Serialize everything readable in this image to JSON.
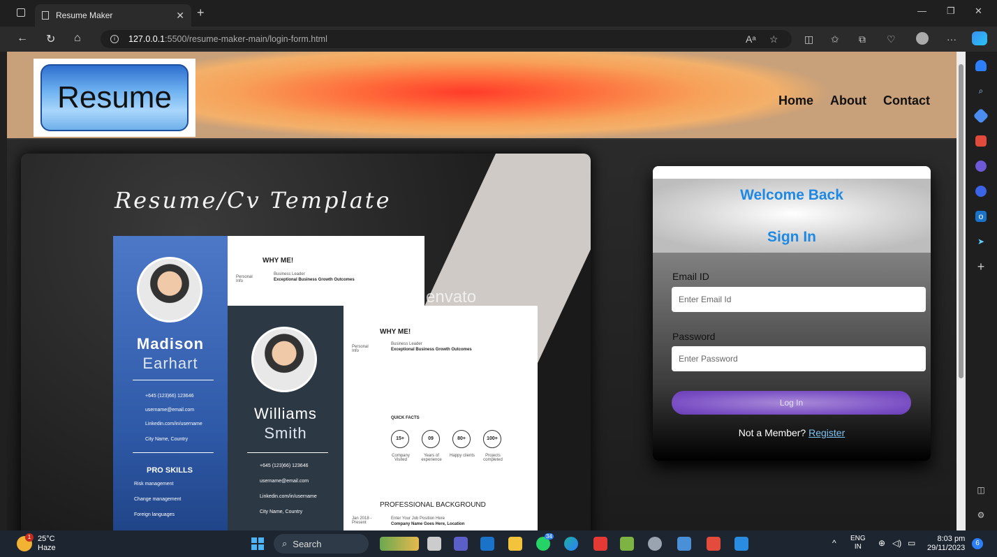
{
  "browser": {
    "tab_title": "Resume Maker",
    "url_host": "127.0.0.1",
    "url_path": ":5500/resume-maker-main/login-form.html",
    "read_aloud": "Aᵃ"
  },
  "site": {
    "logo_text": "Resume",
    "nav": [
      "Home",
      "About",
      "Contact"
    ]
  },
  "template": {
    "title": "Resume/Cv Template",
    "watermark": "envato",
    "cv1": {
      "first": "Madison",
      "last": "Earhart",
      "section": "WHY ME!",
      "role": "Business Leader",
      "tag": "Exceptional Business Growth Outcomes",
      "info": "Personal Info",
      "contacts": [
        "+645 (123)66) 123646",
        "username@email.com",
        "Linkedin.com/in/username",
        "City Name, Country"
      ],
      "skills_title": "PRO SKILLS",
      "skills": [
        "Risk management",
        "Change management",
        "Foreign languages"
      ]
    },
    "cv2": {
      "first": "Williams",
      "last": "Smith",
      "section": "WHY ME!",
      "role": "Business Leader",
      "tag": "Exceptional Business Growth Outcomes",
      "info": "Personal Info",
      "contacts": [
        "+645 (123)66) 123646",
        "username@email.com",
        "Linkedin.com/in/username",
        "City Name, Country"
      ],
      "quick_facts": "QUICK FACTS",
      "facts": [
        {
          "value": "15+",
          "label": "Company Visited"
        },
        {
          "value": "09",
          "label": "Years of experience"
        },
        {
          "value": "80+",
          "label": "Happy clients"
        },
        {
          "value": "100+",
          "label": "Projects completed"
        }
      ],
      "background": "PROFESSIONAL BACKGROUND",
      "job_date": "Jan 2018 - Present",
      "job_title": "Enter Your Job Position Here",
      "job_company": "Company Name Goes Here, Location"
    }
  },
  "login": {
    "welcome": "Welcome Back",
    "signin": "Sign In",
    "email_label": "Email ID",
    "email_placeholder": "Enter Email Id",
    "password_label": "Password",
    "password_placeholder": "Enter Password",
    "button": "Log In",
    "member_text": "Not a Member?",
    "register": "Register"
  },
  "taskbar": {
    "temp": "25°C",
    "weather": "Haze",
    "weather_badge": "1",
    "search": "Search",
    "whatsapp_badge": "34",
    "lang1": "ENG",
    "lang2": "IN",
    "time": "8:03 pm",
    "date": "29/11/2023",
    "notif_count": "6"
  },
  "colors": {
    "accent_blue": "#1e88e5",
    "login_button": "#7a4fc4",
    "header_glow": "#ff3b2a"
  }
}
